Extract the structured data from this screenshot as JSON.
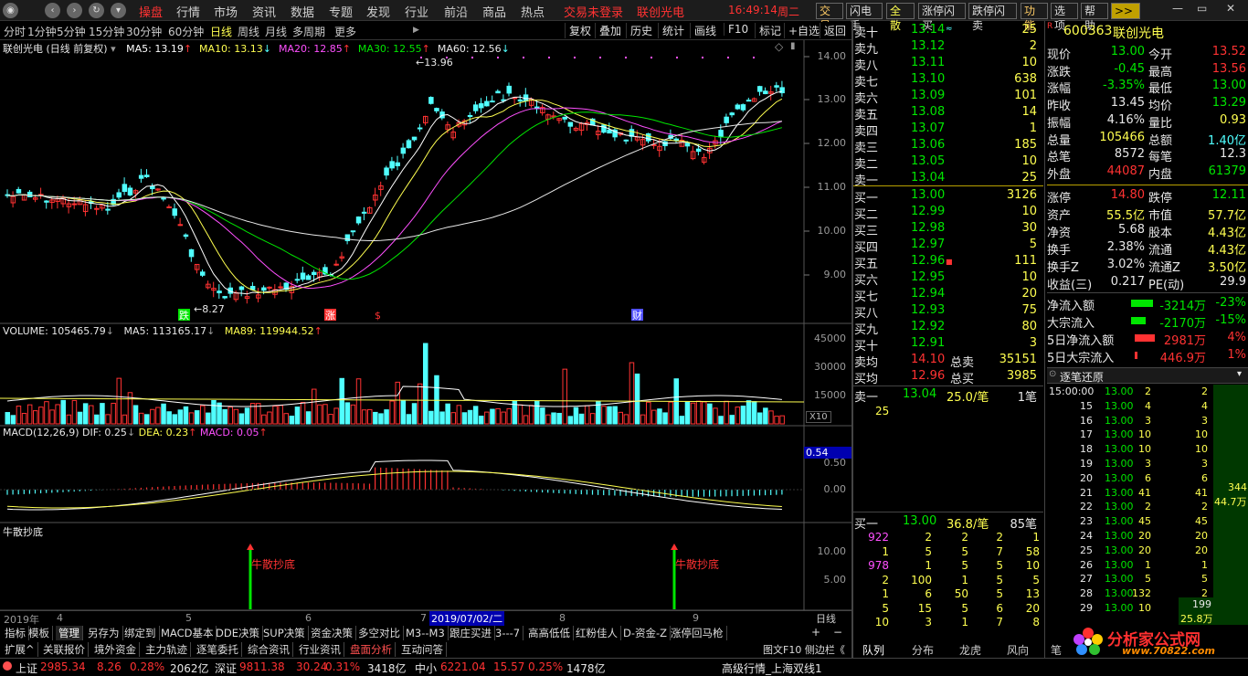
{
  "topbar": {
    "menus": [
      "操盘",
      "行情",
      "市场",
      "资讯",
      "数据",
      "专题",
      "发现",
      "行业",
      "前沿",
      "商品",
      "热点"
    ],
    "login_status": "交易未登录",
    "stock_title": "联创光电",
    "time": "16:49:14",
    "weekday": "周二",
    "buttons": [
      "交易",
      "闪电手",
      "全散",
      "涨停闪买",
      "跌停闪卖",
      "功能",
      "选项",
      "帮助",
      ">>"
    ]
  },
  "periodbar": {
    "periods": [
      "分时",
      "1分钟",
      "5分钟",
      "15分钟",
      "30分钟",
      "60分钟",
      "日线",
      "周线",
      "月线",
      "多周期",
      "更多"
    ],
    "active": "日线",
    "tools": [
      "复权",
      "叠加",
      "历史",
      "统计",
      "画线",
      "F10",
      "标记",
      "+自选",
      "返回"
    ]
  },
  "main_chart": {
    "title": "联创光电 (日线 前复权)",
    "ma": [
      {
        "label": "MA5: 13.19",
        "color": "#ffffff"
      },
      {
        "label": "MA10: 13.13",
        "color": "#ffff50"
      },
      {
        "label": "MA20: 12.85",
        "color": "#ff50ff"
      },
      {
        "label": "MA30: 12.55",
        "color": "#00e600"
      },
      {
        "label": "MA60: 12.56",
        "color": "#e8e8e8"
      }
    ],
    "y_ticks": [
      "14.00",
      "13.00",
      "12.00",
      "11.00",
      "10.00",
      "9.00"
    ],
    "high_label": "13.96",
    "low_label": "8.27",
    "markers": [
      "跌",
      "涨",
      "$",
      "财"
    ]
  },
  "volume_chart": {
    "legend": "VOLUME: 105465.79",
    "ma5": "MA5: 113165.17",
    "ma89": "MA89: 119944.52",
    "y_ticks": [
      "45000",
      "30000",
      "15000"
    ],
    "unit": "X10"
  },
  "macd_chart": {
    "legend": "MACD(12,26,9)",
    "dif": "DIF: 0.25",
    "dea": "DEA: 0.23",
    "macd": "MACD: 0.05",
    "y_ticks": [
      "0.50",
      "0.00"
    ],
    "marker": "0.54"
  },
  "signal_chart": {
    "legend": "牛散抄底",
    "label": "牛散抄底",
    "y_ticks": [
      "10.00",
      "5.00"
    ]
  },
  "x_axis": {
    "labels": [
      "2019年",
      "4",
      "5",
      "6",
      "7",
      "8",
      "9"
    ],
    "cursor_date": "2019/07/02/二",
    "period": "日线"
  },
  "bottom_tabs": [
    "指标",
    "模板",
    "管理",
    "另存为",
    "绑定到",
    "MACD基本",
    "DDE决策",
    "SUP决策",
    "资金决策",
    "多空对比",
    "M3--M3",
    "跟庄买进",
    "3---7",
    "高高低低",
    "红粉佳人",
    "D-资金-Z",
    "涨停回马枪"
  ],
  "bottom_tabs2": [
    "扩展^",
    "关联报价",
    "境外资金",
    "主力轨迹",
    "逐笔委托",
    "综合资讯",
    "行业资讯",
    "盘面分析",
    "互动问答"
  ],
  "bottom_tabs2_right": "图文F10 侧边栏《",
  "order_book": {
    "sells": [
      {
        "label": "卖十",
        "price": "13.14",
        "vol": "25"
      },
      {
        "label": "卖九",
        "price": "13.12",
        "vol": "2"
      },
      {
        "label": "卖八",
        "price": "13.11",
        "vol": "10"
      },
      {
        "label": "卖七",
        "price": "13.10",
        "vol": "638"
      },
      {
        "label": "卖六",
        "price": "13.09",
        "vol": "101"
      },
      {
        "label": "卖五",
        "price": "13.08",
        "vol": "14"
      },
      {
        "label": "卖四",
        "price": "13.07",
        "vol": "1"
      },
      {
        "label": "卖三",
        "price": "13.06",
        "vol": "185"
      },
      {
        "label": "卖二",
        "price": "13.05",
        "vol": "10"
      },
      {
        "label": "卖一",
        "price": "13.04",
        "vol": "25"
      }
    ],
    "buys": [
      {
        "label": "买一",
        "price": "13.00",
        "vol": "3126"
      },
      {
        "label": "买二",
        "price": "12.99",
        "vol": "10"
      },
      {
        "label": "买三",
        "price": "12.98",
        "vol": "30"
      },
      {
        "label": "买四",
        "price": "12.97",
        "vol": "5"
      },
      {
        "label": "买五",
        "price": "12.96",
        "vol": "111"
      },
      {
        "label": "买六",
        "price": "12.95",
        "vol": "10"
      },
      {
        "label": "买七",
        "price": "12.94",
        "vol": "20"
      },
      {
        "label": "买八",
        "price": "12.93",
        "vol": "75"
      },
      {
        "label": "买九",
        "price": "12.92",
        "vol": "80"
      },
      {
        "label": "买十",
        "price": "12.91",
        "vol": "3"
      }
    ],
    "avg_sell": {
      "label": "卖均",
      "price": "14.10",
      "name": "总卖",
      "vol": "35151"
    },
    "avg_buy": {
      "label": "买均",
      "price": "12.96",
      "name": "总买",
      "vol": "3985"
    },
    "queue_sell": {
      "label": "卖一",
      "price": "13.04",
      "detail": "25.0/笔",
      "count": "1笔",
      "first": "25"
    },
    "queue_buy": {
      "label": "买一",
      "price": "13.00",
      "detail": "36.8/笔",
      "count": "85笔"
    },
    "queue_rows": [
      [
        "922",
        "2",
        "2",
        "2",
        "1"
      ],
      [
        "1",
        "5",
        "5",
        "7",
        "58"
      ],
      [
        "978",
        "1",
        "5",
        "5",
        "10"
      ],
      [
        "2",
        "100",
        "1",
        "5",
        "5"
      ],
      [
        "1",
        "6",
        "50",
        "5",
        "13"
      ],
      [
        "5",
        "15",
        "5",
        "6",
        "20"
      ],
      [
        "10",
        "3",
        "1",
        "7",
        "8"
      ]
    ]
  },
  "quote": {
    "code": "600363",
    "name": "联创光电",
    "rows": [
      [
        "现价",
        "13.00",
        "今开",
        "13.52"
      ],
      [
        "涨跌",
        "-0.45",
        "最高",
        "13.56"
      ],
      [
        "涨幅",
        "-3.35%",
        "最低",
        "13.00"
      ],
      [
        "昨收",
        "13.45",
        "均价",
        "13.29"
      ],
      [
        "振幅",
        "4.16%",
        "量比",
        "0.93"
      ],
      [
        "总量",
        "105466",
        "总额",
        "1.40亿"
      ],
      [
        "总笔",
        "8572",
        "每笔",
        "12.3"
      ],
      [
        "外盘",
        "44087",
        "内盘",
        "61379"
      ],
      [
        "涨停",
        "14.80",
        "跌停",
        "12.11"
      ],
      [
        "资产",
        "55.5亿",
        "市值",
        "57.7亿"
      ],
      [
        "净资",
        "5.68",
        "股本",
        "4.43亿"
      ],
      [
        "换手",
        "2.38%",
        "流通",
        "4.43亿"
      ],
      [
        "换手Z",
        "3.02%",
        "流通Z",
        "3.50亿"
      ],
      [
        "收益(三)",
        "0.217",
        "PE(动)",
        "29.9"
      ]
    ],
    "flows": [
      {
        "label": "净流入额",
        "value": "-3214万",
        "pct": "-23%",
        "color": "#00e600",
        "bar": 0.6
      },
      {
        "label": "大宗流入",
        "value": "-2170万",
        "pct": "-15%",
        "color": "#00e600",
        "bar": 0.4
      },
      {
        "label": "5日净流入额",
        "value": "2981万",
        "pct": "4%",
        "color": "#ff3232",
        "bar": 0.55
      },
      {
        "label": "5日大宗流入",
        "value": "446.9万",
        "pct": "1%",
        "color": "#ff3232",
        "bar": 0.08
      }
    ]
  },
  "ticks": {
    "title": "逐笔还原",
    "rows": [
      [
        "15:00:00",
        "13.00",
        "2",
        "2"
      ],
      [
        "15",
        "13.00",
        "4",
        "4"
      ],
      [
        "16",
        "13.00",
        "3",
        "3"
      ],
      [
        "17",
        "13.00",
        "10",
        "10"
      ],
      [
        "18",
        "13.00",
        "10",
        "10"
      ],
      [
        "19",
        "13.00",
        "3",
        "3"
      ],
      [
        "20",
        "13.00",
        "6",
        "6"
      ],
      [
        "21",
        "13.00",
        "41",
        "41"
      ],
      [
        "22",
        "13.00",
        "2",
        "2"
      ],
      [
        "23",
        "13.00",
        "45",
        "45"
      ],
      [
        "24",
        "13.00",
        "20",
        "20"
      ],
      [
        "25",
        "13.00",
        "20",
        "20"
      ],
      [
        "26",
        "13.00",
        "1",
        "1"
      ],
      [
        "27",
        "13.00",
        "5",
        "5"
      ],
      [
        "28",
        "13.00",
        "132",
        "2"
      ],
      [
        "29",
        "13.00",
        "10",
        "10"
      ]
    ],
    "side_total": "344",
    "side_amount": "44.7万",
    "side_total2": "199",
    "side_amount2": "25.8万"
  },
  "right_tabs": [
    "队列",
    "分布",
    "龙虎",
    "风向",
    "笔"
  ],
  "watermark": {
    "brand": "分析家公式网",
    "url": "www.70822.com"
  },
  "statusbar": [
    {
      "name": "上证",
      "value": "2985.34",
      "chg": "8.26",
      "pct": "0.28%",
      "amt": "2062亿"
    },
    {
      "name": "深证",
      "value": "9811.38",
      "chg": "30.24",
      "pct": "0.31%",
      "amt": "3418亿"
    },
    {
      "name": "中小",
      "value": "6221.04",
      "chg": "15.57",
      "pct": "0.25%",
      "amt": "1478亿"
    }
  ],
  "status_right": "高级行情_上海双线1"
}
